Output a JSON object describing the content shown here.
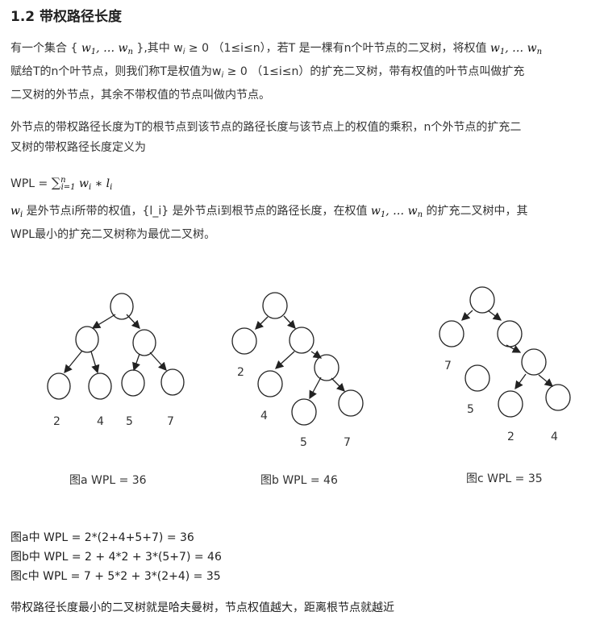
{
  "title": "1.2 带权路径长度",
  "p1": {
    "t1": "有一个集合 {",
    "t2": "},其中 w",
    "t3": " ≥ 0 （1≤i≤n），若T 是一棵有n个叶节点的二叉树，将权值",
    "t4": "赋给T的n个叶节点，则我们称T是权值为w",
    "t5": " ≥ 0 （1≤i≤n）的扩充二叉树，带有权值的叶节点叫做扩充",
    "t6": "二叉树的外节点，其余不带权值的节点叫做内节点。"
  },
  "p2": {
    "line1": "外节点的带权路径长度为T的根节点到该节点的路径长度与该节点上的权值的乘积，n个外节点的扩充二",
    "line2": "叉树的带权路径长度定义为"
  },
  "formula": {
    "lhs": "WPL ="
  },
  "p4": {
    "t1": "是外节点i所带的权值，{l_i} 是外节点i到根节点的路径长度，在权值",
    "t2": "的扩充二叉树中，其",
    "line2": "WPL最小的扩充二叉树称为最优二叉树。"
  },
  "figures": {
    "a": {
      "caption": "图a   WPL = 36",
      "weights": [
        "2",
        "4",
        "5",
        "7"
      ]
    },
    "b": {
      "caption": "图b   WPL = 46",
      "weights": [
        "2",
        "4",
        "5",
        "7"
      ]
    },
    "c": {
      "caption": "图c   WPL = 35",
      "weights": [
        "7",
        "5",
        "2",
        "4"
      ]
    }
  },
  "calculations": [
    "图a中 WPL = 2*(2+4+5+7) = 36",
    "图b中 WPL = 2 + 4*2 + 3*(5+7) = 46",
    "图c中 WPL = 7 + 5*2 + 3*(2+4) = 35"
  ],
  "conclusion": "带权路径长度最小的二叉树就是哈夫曼树，节点权值越大，距离根节点就越近"
}
